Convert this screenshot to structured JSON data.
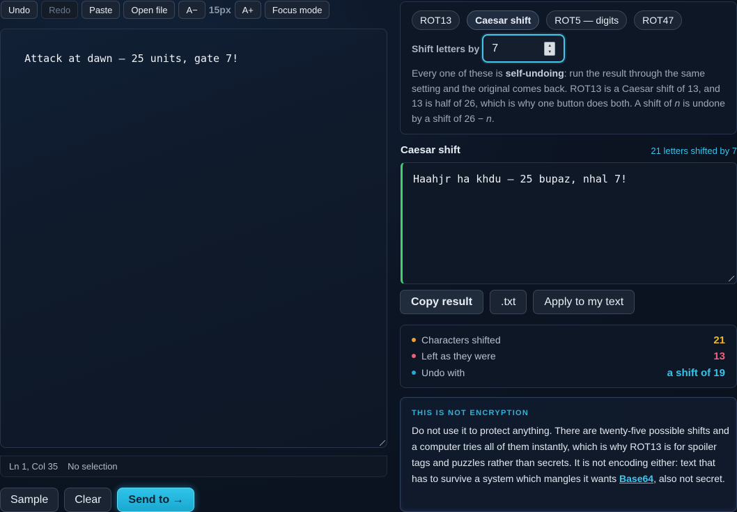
{
  "toolbar": {
    "undo": "Undo",
    "redo": "Redo",
    "paste": "Paste",
    "open_file": "Open file",
    "font_decrease": "A−",
    "font_size": "15px",
    "font_increase": "A+",
    "focus_mode": "Focus mode"
  },
  "editor": {
    "text": "Attack at dawn — 25 units, gate 7!"
  },
  "status": {
    "position": "Ln 1, Col 35",
    "selection": "No selection"
  },
  "actions": {
    "sample": "Sample",
    "clear": "Clear",
    "send_to": "Send to →"
  },
  "modes": {
    "tabs": [
      "ROT13",
      "Caesar shift",
      "ROT5 — digits",
      "ROT47"
    ],
    "active": "Caesar shift",
    "shift_label": "Shift letters by",
    "shift_value": "7",
    "desc_1": "Every one of these is ",
    "desc_bold": "self-undoing",
    "desc_2": ": run the result through the same setting and the original comes back. ROT13 is a Caesar shift of 13, and 13 is half of 26, which is why one button does both. A shift of ",
    "desc_n1": "n",
    "desc_3": " is undone by a shift of 26 − ",
    "desc_n2": "n",
    "desc_4": "."
  },
  "result": {
    "title": "Caesar shift",
    "meta": "21 letters shifted by 7",
    "text": "Haahjr ha khdu — 25 bupaz, nhal 7!",
    "copy": "Copy result",
    "txt": ".txt",
    "apply": "Apply to my text"
  },
  "stats": [
    {
      "label": "Characters shifted",
      "value": "21",
      "color": "#f0b429"
    },
    {
      "label": "Left as they were",
      "value": "13",
      "color": "#f0607a"
    },
    {
      "label": "Undo with",
      "value": "a shift of 19",
      "color": "#38c3ea"
    }
  ],
  "warning": {
    "heading": "THIS IS NOT ENCRYPTION",
    "body_1": "Do not use it to protect anything. There are twenty-five possible shifts and a computer tries all of them instantly, which is why ROT13 is for spoiler tags and puzzles rather than secrets. It is not encoding either: text that has to survive a system which mangles it wants ",
    "link": "Base64",
    "body_2": ", also not secret."
  }
}
